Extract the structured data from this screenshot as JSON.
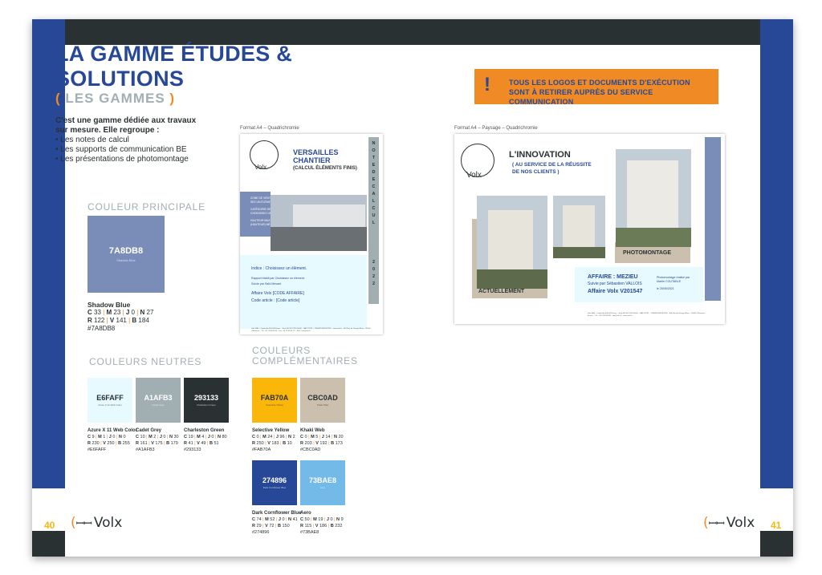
{
  "pages": {
    "left": {
      "open": "(",
      "num": "40",
      "close": ")"
    },
    "right": {
      "open": "(",
      "num": "41",
      "close": ")"
    }
  },
  "logo": {
    "mark": "ꟷꟷ",
    "text": "Volx",
    "left_open": "(",
    "right_open": "("
  },
  "heading": {
    "line1": "LA GAMME ÉTUDES &",
    "line2": "SOLUTIONS",
    "sub_open": "(",
    "sub": " LES GAMMES ",
    "sub_close": ")"
  },
  "intro": {
    "lead": "C'est une gamme dédiée aux travaux sur mesure. Elle regroupe :",
    "items": [
      "Les notes de calcul",
      "Les supports de communication BE",
      "Les présentations de photomontage"
    ]
  },
  "sections": {
    "primary": "COULEUR PRINCIPALE",
    "neutral": "COULEURS NEUTRES",
    "complementary_1": "COULEURS",
    "complementary_2": "COMPLÉMENTAIRES"
  },
  "primary_color": {
    "hex_label": "7A8DB8",
    "small": "Shadow Blue",
    "name": "Shadow Blue",
    "cmyk": [
      "C",
      "33",
      "M",
      "23",
      "J",
      "0",
      "N",
      "27"
    ],
    "rvb": [
      "R",
      "122",
      "V",
      "141",
      "B",
      "184"
    ],
    "hex": "#7A8DB8"
  },
  "neutral_colors": [
    {
      "hex_label": "E6FAFF",
      "small": "Azure X 11 Web Color",
      "name": "Azure X 11 Web Color",
      "cmyk": [
        "C",
        "9",
        "M",
        "1",
        "J",
        "0",
        "N",
        "0"
      ],
      "rvb": [
        "R",
        "230",
        "V",
        "250",
        "B",
        "255"
      ],
      "hex": "#E6FAFF",
      "bg": "#E6FAFF",
      "fg": "#293133"
    },
    {
      "hex_label": "A1AFB3",
      "small": "Cadet Grey",
      "name": "Cadet Grey",
      "cmyk": [
        "C",
        "10",
        "M",
        "2",
        "J",
        "0",
        "N",
        "30"
      ],
      "rvb": [
        "R",
        "161",
        "V",
        "175",
        "B",
        "179"
      ],
      "hex": "#A1AFB3",
      "bg": "#A1AFB3",
      "fg": "#ffffff"
    },
    {
      "hex_label": "293133",
      "small": "Charleston Green",
      "name": "Charleston Green",
      "cmyk": [
        "C",
        "19",
        "M",
        "4",
        "J",
        "0",
        "N",
        "80"
      ],
      "rvb": [
        "R",
        "41",
        "V",
        "49",
        "B",
        "51"
      ],
      "hex": "#293133",
      "bg": "#293133",
      "fg": "#ffffff"
    }
  ],
  "complementary_colors": [
    {
      "hex_label": "FAB70A",
      "small": "Selective Yellow",
      "name": "Selective Yellow",
      "cmyk": [
        "C",
        "0",
        "M",
        "24",
        "J",
        "96",
        "N",
        "2"
      ],
      "rvb": [
        "R",
        "250",
        "V",
        "183",
        "B",
        "10"
      ],
      "hex": "#FAB70A",
      "bg": "#FAB70A",
      "fg": "#293133"
    },
    {
      "hex_label": "CBC0AD",
      "small": "Khaki Web",
      "name": "Khaki Web",
      "cmyk": [
        "C",
        "0",
        "M",
        "5",
        "J",
        "14",
        "N",
        "20"
      ],
      "rvb": [
        "R",
        "203",
        "V",
        "192",
        "B",
        "173"
      ],
      "hex": "#CBC0AD",
      "bg": "#CBC0AD",
      "fg": "#293133"
    },
    {
      "hex_label": "274896",
      "small": "Dark Cornflower Blue",
      "name": "Dark Cornflower Blue",
      "cmyk": [
        "C",
        "74",
        "M",
        "52",
        "J",
        "0",
        "N",
        "41"
      ],
      "rvb": [
        "R",
        "29",
        "V",
        "72",
        "B",
        "150"
      ],
      "hex": "#274896",
      "bg": "#274896",
      "fg": "#ffffff"
    },
    {
      "hex_label": "73BAE8",
      "small": "Aero",
      "name": "Aero",
      "cmyk": [
        "C",
        "50",
        "M",
        "19",
        "J",
        "0",
        "N",
        "9"
      ],
      "rvb": [
        "R",
        "115",
        "V",
        "186",
        "B",
        "232"
      ],
      "hex": "#73BAE8",
      "bg": "#73BAE8",
      "fg": "#ffffff"
    }
  ],
  "doc1": {
    "format": "Format A4 – Quadrichromie",
    "brand": "Volx",
    "title1": "VERSAILLES",
    "title2": "CHANTIER",
    "title3": "(CALCUL ÉLÉMENTS FINIS)",
    "side": [
      "N",
      "O",
      "T",
      "E",
      "D",
      "E",
      "C",
      "A",
      "L",
      "C",
      "U",
      "L",
      "2",
      "0",
      "2",
      "2"
    ],
    "zone": [
      "ZONE DE VENT : CHOISIS-",
      "SEZ UN ÉLÉMENT.",
      "CATÉGORIE DE TERRAIN :",
      "CHOISISSEZ UN ÉLÉMENT.",
      "HAUTEUR MAX BÂTIMENT",
      "(HAUTEUR) MÈTRES."
    ],
    "indice": "Indice : Choisissez un élément.",
    "report": "Rapport établi par Choisissez un élément.",
    "follow": "Suivie par Saïd Mevant",
    "affaire": "Affaire Volx [CODE AFFAIRE]",
    "code": "Code article : [Code article]",
    "foot": "Volx SAS – Capital de 500 000 Euros – Siret 402 467 355 00046 – NAF 2223Z – TVA FR24402467355 – www.volx.fr · 466 Rue de Grange Blanc – 82400 Villeneuve – Tél : 04 74 46 84 89 – Fax : 04 74 46 84 79 – Mail : bat@volx.fr"
  },
  "doc2": {
    "format": "Format A4 – Paysage – Quadrichromie",
    "brand": "Volx",
    "headline": "L'INNOVATION",
    "sub1": "( AU SERVICE DE LA RÉUSSITE",
    "sub2": "DE NOS CLIENTS )",
    "tag_before": "ACTUELLEMENT",
    "tag_after": "PHOTOMONTAGE",
    "affaire": "AFFAIRE : MEZIEU",
    "follow": "Suivie par Sébastien VALLOIS",
    "code": "Affaire Volx V201547",
    "note1": "Photomontage réalisé par",
    "note2": "Martin COUTABLE",
    "date": "le 25/05/2021",
    "foot": "Volx SAS – Capital de 500 000 Euros – Siret 402 467 355 00046 – NAF 2223Z – TVA FR24402467355 · 466 Rue de Grange Blanc – 82400 Villeneuve – France – Tél : 04 74 46 84 89 – bat@volx.fr – www.volx.fr"
  },
  "warning": {
    "mark": "!",
    "line1": "TOUS LES LOGOS ET DOCUMENTS D'EXÉCUTION",
    "line2": "SONT À RETIRER AUPRÈS DU SERVICE COMMUNICATION"
  }
}
